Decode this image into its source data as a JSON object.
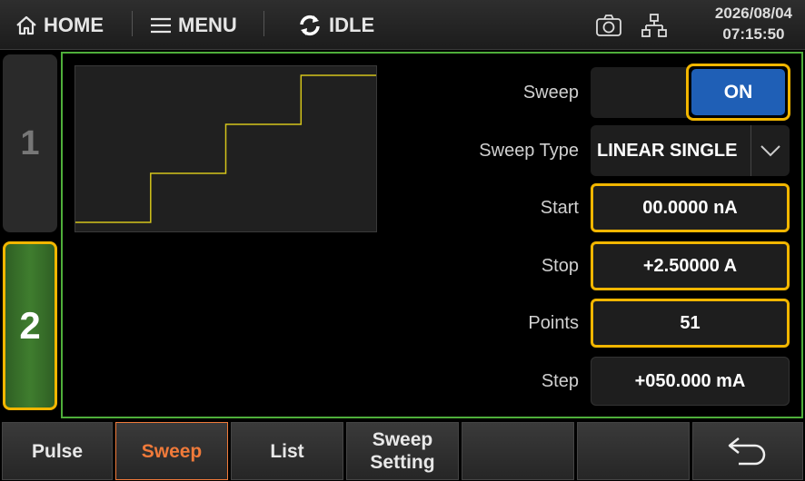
{
  "topbar": {
    "home_label": "HOME",
    "menu_label": "MENU",
    "status_label": "IDLE",
    "date": "2026/08/04",
    "time": "07:15:50"
  },
  "channels": [
    {
      "label": "1",
      "active": false
    },
    {
      "label": "2",
      "active": true
    }
  ],
  "sweep": {
    "sweep_label": "Sweep",
    "sweep_state": "ON",
    "type_label": "Sweep Type",
    "type_value": "LINEAR SINGLE",
    "start_label": "Start",
    "start_value": "00.0000 nA",
    "stop_label": "Stop",
    "stop_value": "+2.50000 A",
    "points_label": "Points",
    "points_value": "51",
    "step_label": "Step",
    "step_value": "+050.000 mA"
  },
  "preview": {
    "line_color": "#d4c41a",
    "levels": [
      0,
      1,
      2,
      3
    ]
  },
  "bottom": {
    "buttons": [
      {
        "label": "Pulse"
      },
      {
        "label": "Sweep"
      },
      {
        "label": "List"
      },
      {
        "label": "Sweep\nSetting"
      },
      {
        "label": ""
      },
      {
        "label": ""
      }
    ],
    "active_index": 1
  },
  "colors": {
    "accent_highlight": "#f2b600",
    "panel_border": "#4fae3a",
    "toggle_on": "#1f5fb6",
    "active_tab_text": "#f07a3a"
  }
}
